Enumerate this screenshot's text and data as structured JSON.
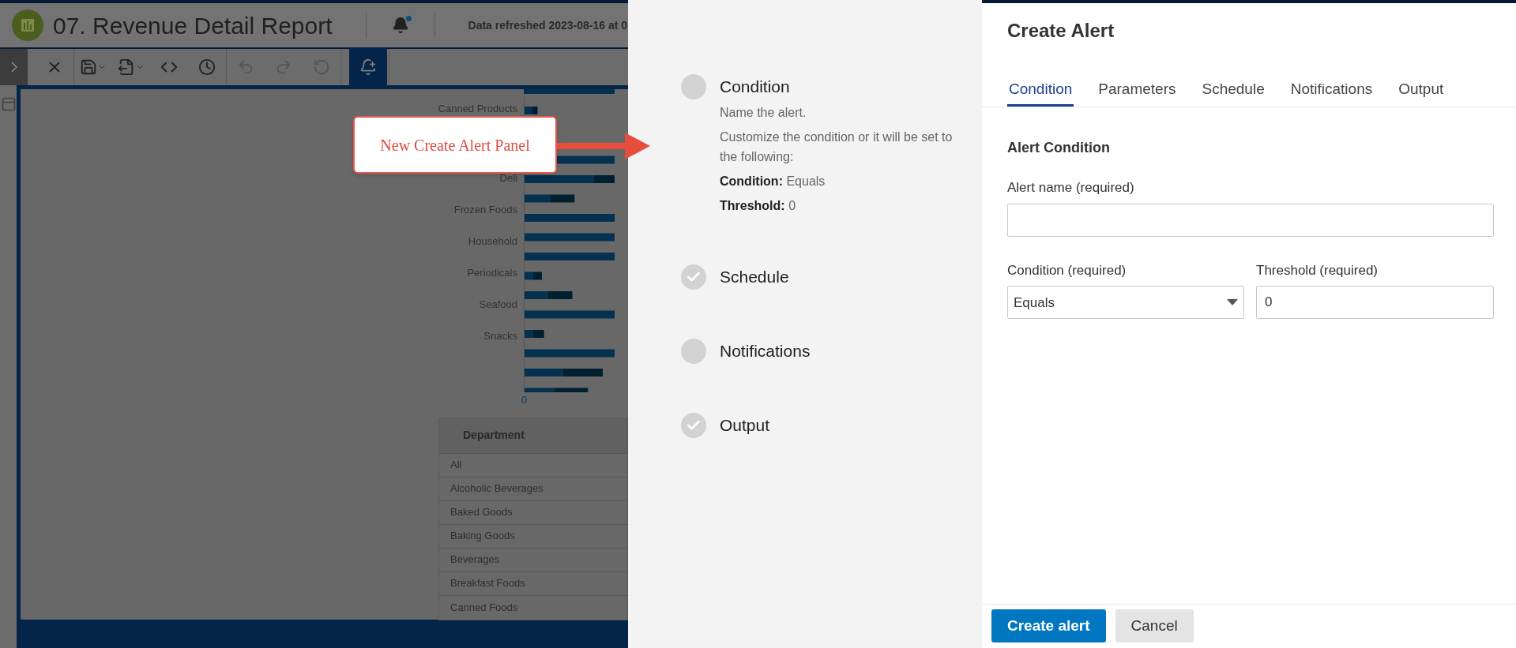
{
  "report": {
    "title": "07. Revenue Detail Report",
    "refreshed": "Data refreshed 2023-08-16 at 0",
    "chart": {
      "categories": [
        "Canned Products",
        "Deli",
        "Frozen Foods",
        "Household",
        "Periodicals",
        "Seafood",
        "Snacks"
      ],
      "axis_tick": "0"
    },
    "table": {
      "column": "Department",
      "rows": [
        "All",
        "Alcoholic Beverages",
        "Baked Goods",
        "Baking Goods",
        "Beverages",
        "Breakfast Foods",
        "Canned Foods"
      ]
    }
  },
  "callout": "New Create Alert Panel",
  "steps": [
    {
      "label": "Condition",
      "complete": false,
      "description": [
        "Name the alert.",
        "Customize the condition or it will be set to the following:"
      ],
      "settings": [
        {
          "label": "Condition:",
          "value": "Equals"
        },
        {
          "label": "Threshold:",
          "value": "0"
        }
      ]
    },
    {
      "label": "Schedule",
      "complete": true
    },
    {
      "label": "Notifications",
      "complete": false
    },
    {
      "label": "Output",
      "complete": true
    }
  ],
  "panel": {
    "title": "Create Alert",
    "tabs": [
      {
        "label": "Condition",
        "selected": true
      },
      {
        "label": "Parameters",
        "selected": false
      },
      {
        "label": "Schedule",
        "selected": false
      },
      {
        "label": "Notifications",
        "selected": false
      },
      {
        "label": "Output",
        "selected": false
      }
    ],
    "section": "Alert Condition",
    "name_label": "Alert name (required)",
    "condition_label": "Condition (required)",
    "condition_value": "Equals",
    "threshold_label": "Threshold (required)",
    "threshold_value": "0",
    "buttons": [
      {
        "label": "Create alert",
        "kind": "primary"
      },
      {
        "label": "Cancel",
        "kind": "secondary"
      }
    ]
  }
}
